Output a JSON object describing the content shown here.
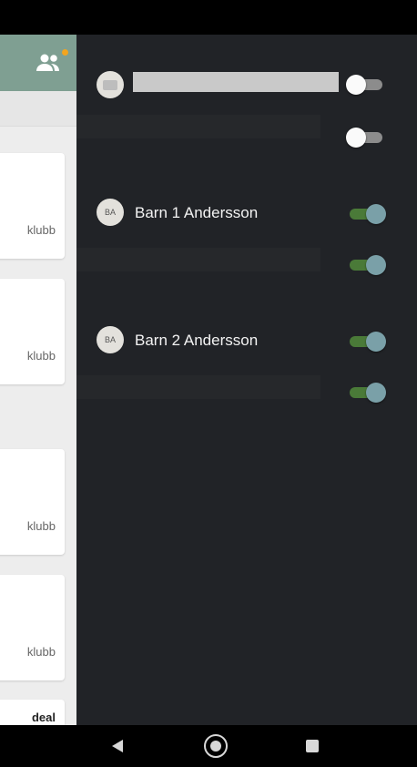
{
  "background_app": {
    "card_labels": [
      "klubb",
      "klubb",
      "klubb",
      "klubb",
      "deal"
    ],
    "topbar_color": "#7f9f92",
    "notification_dot_color": "#f2a51f"
  },
  "drawer": {
    "rows": [
      {
        "initials": "",
        "name": "",
        "main_toggle": "off",
        "sub_toggle": "off"
      },
      {
        "initials": "BA",
        "name": "Barn 1 Andersson",
        "main_toggle": "on",
        "sub_toggle": "on"
      },
      {
        "initials": "BA",
        "name": "Barn 2 Andersson",
        "main_toggle": "on",
        "sub_toggle": "on"
      }
    ],
    "toggle_on_color": "#7aa0a8",
    "background_color": "#212327"
  },
  "navbar": {
    "icons": [
      "back-icon",
      "home-icon",
      "recents-icon"
    ]
  }
}
